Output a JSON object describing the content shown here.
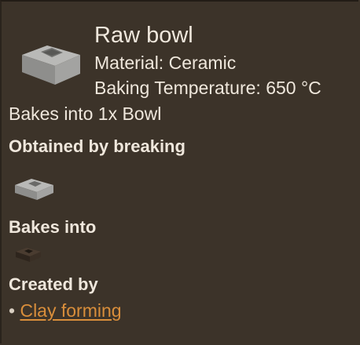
{
  "item": {
    "title": "Raw bowl",
    "material": "Material: Ceramic",
    "baking_temperature": "Baking Temperature: 650 °C",
    "bakes_description": "Bakes into 1x Bowl"
  },
  "sections": {
    "obtained_heading": "Obtained by breaking",
    "bakes_heading": "Bakes into",
    "created_heading": "Created by",
    "created_bullet": "•",
    "created_link": "Clay forming"
  },
  "icons": {
    "header": "raw-bowl-icon",
    "obtained": "raw-bowl-icon",
    "bakes": "fired-bowl-icon"
  },
  "colors": {
    "background": "#3c3329",
    "text": "#efe7dc",
    "link": "#d98e3b"
  }
}
